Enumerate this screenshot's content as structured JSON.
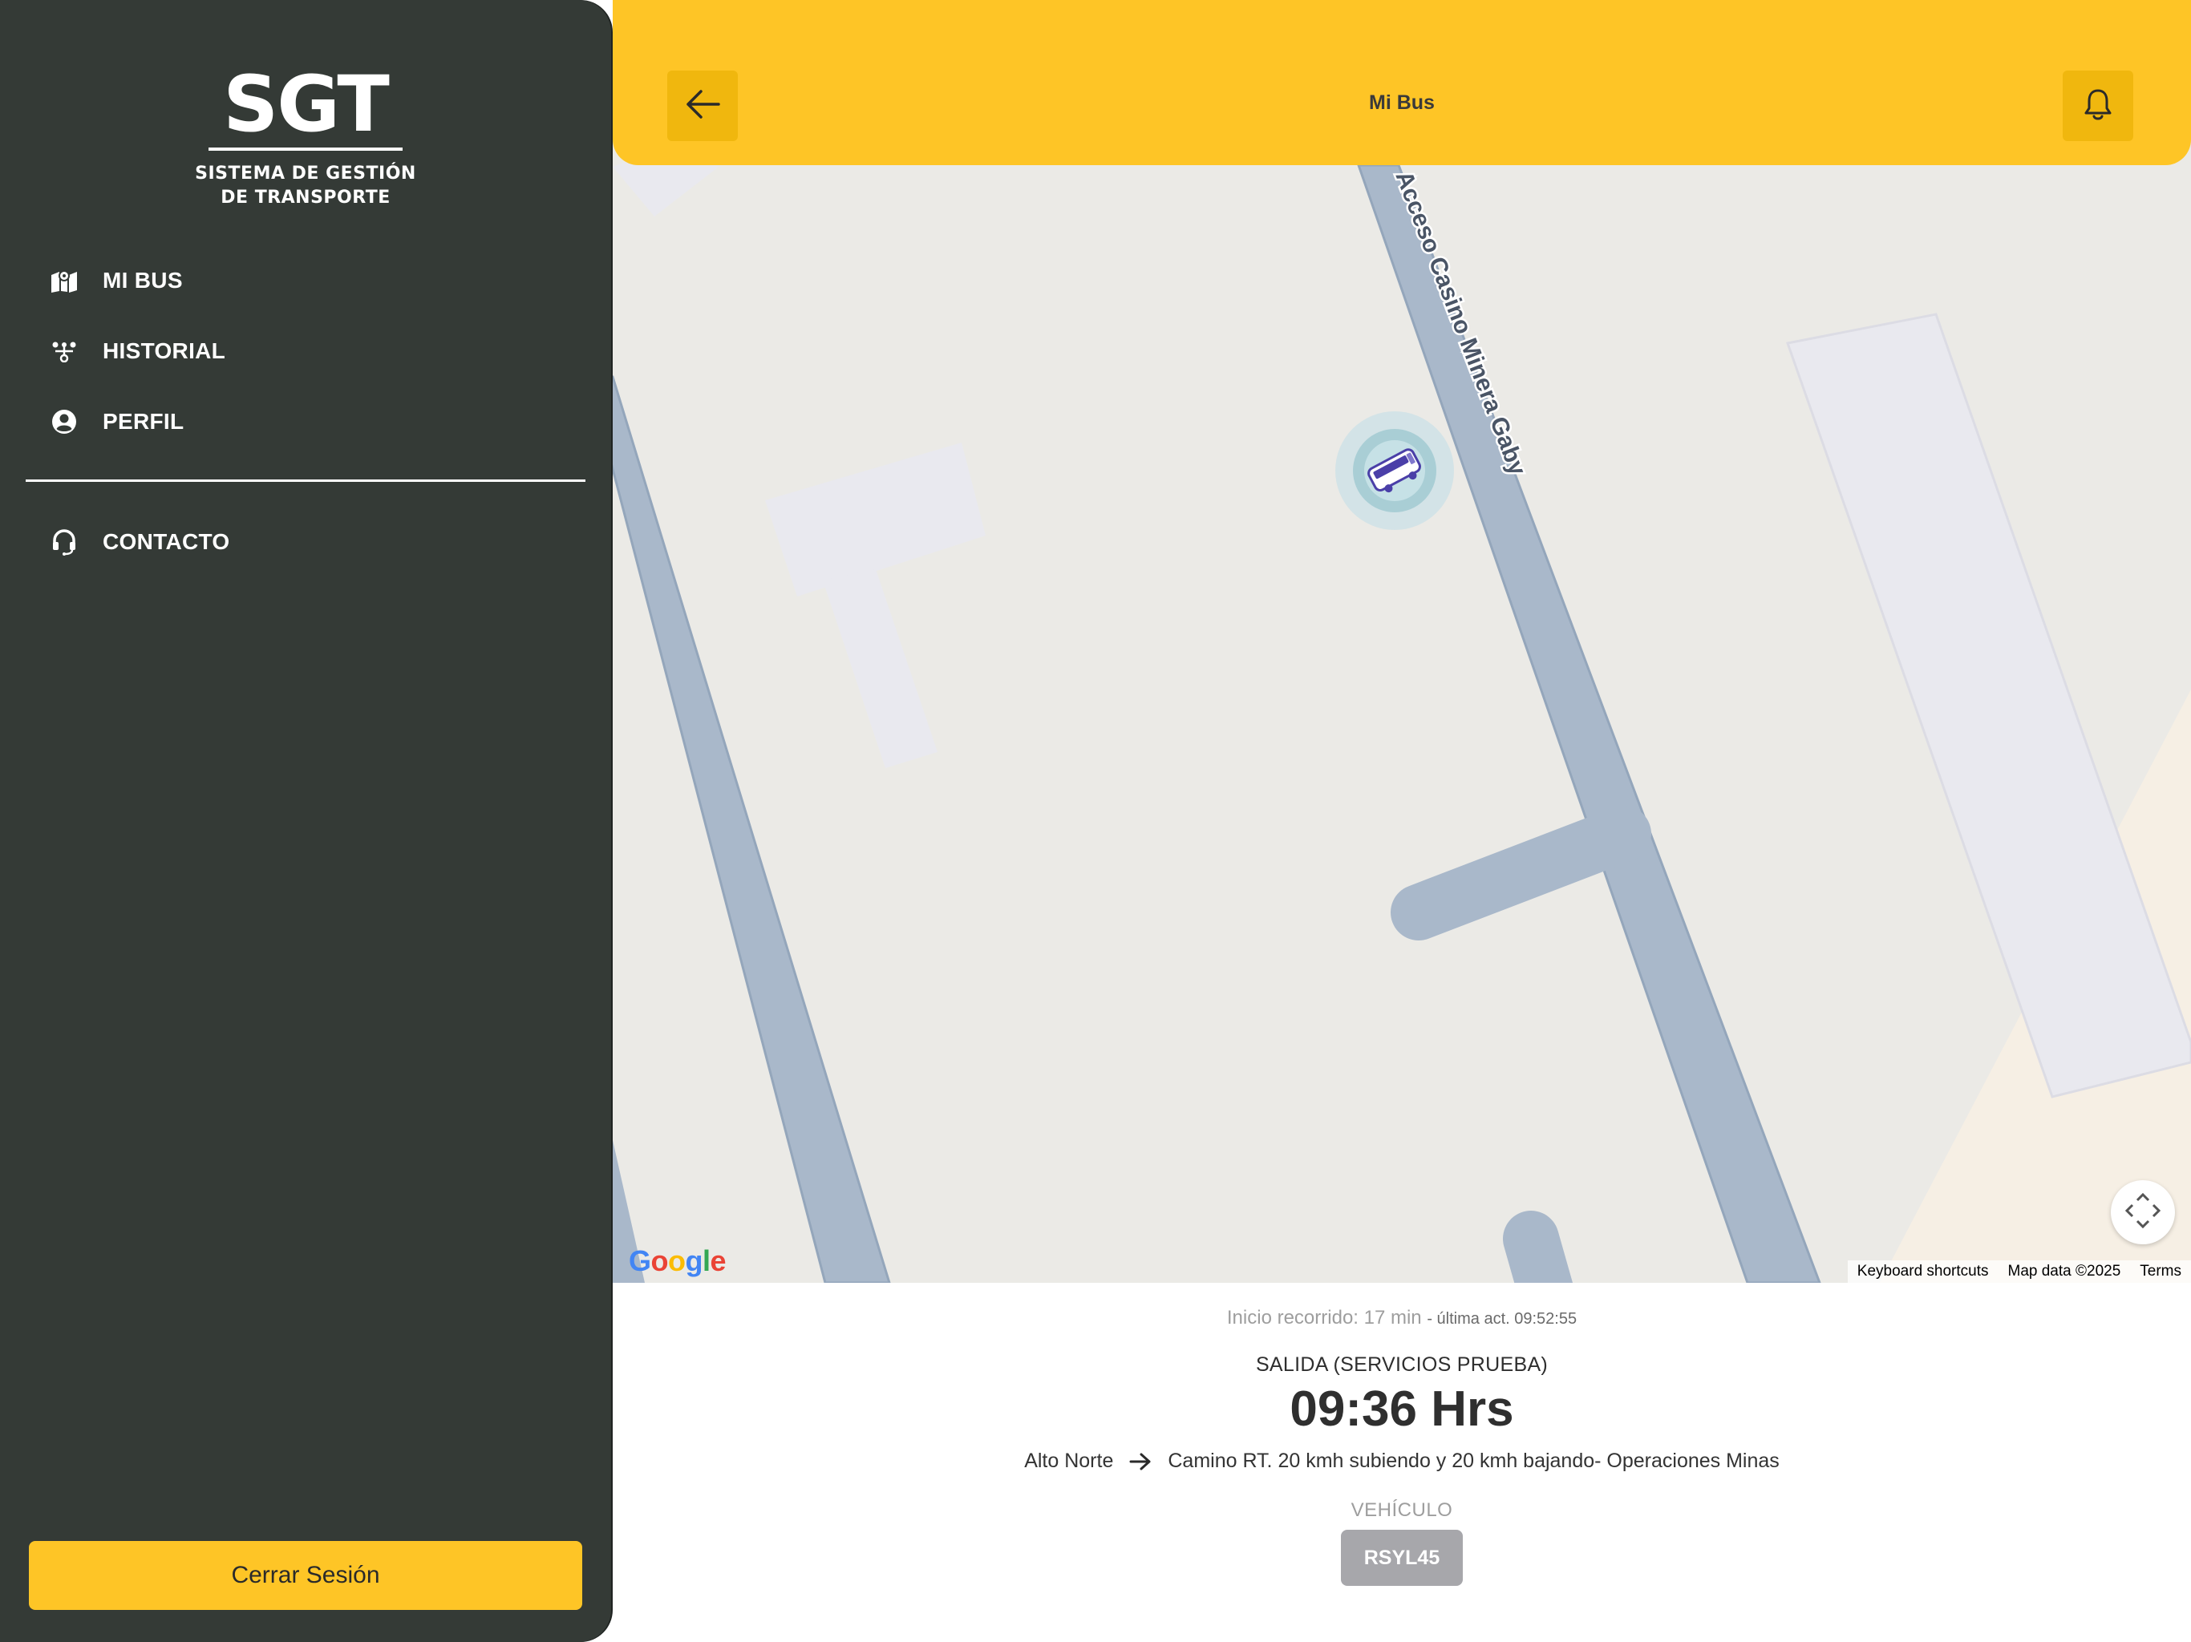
{
  "sidebar": {
    "logo": {
      "mark": "SGT",
      "line1": "SISTEMA DE GESTIÓN",
      "line2": "DE TRANSPORTE"
    },
    "items": [
      {
        "label": "MI BUS",
        "icon": "map-icon"
      },
      {
        "label": "HISTORIAL",
        "icon": "route-icon"
      },
      {
        "label": "PERFIL",
        "icon": "user-circle-icon"
      },
      {
        "label": "CONTACTO",
        "icon": "headset-icon"
      }
    ],
    "logout_label": "Cerrar Sesión"
  },
  "header": {
    "title": "Mi Bus",
    "back_icon": "arrow-left-icon",
    "notification_icon": "bell-icon"
  },
  "map": {
    "street_label": "Acceso Casino Minera Gaby",
    "provider": "Google",
    "attribution": {
      "shortcuts": "Keyboard shortcuts",
      "data": "Map data ©2025",
      "terms": "Terms"
    },
    "marker_icon": "bus-icon",
    "recenter_icon": "recenter-icon"
  },
  "trip": {
    "start_text": "Inicio recorrido: 17 min",
    "last_update_text": "- última act. 09:52:55",
    "departure_label": "SALIDA (SERVICIOS PRUEBA)",
    "departure_time": "09:36 Hrs",
    "origin": "Alto Norte",
    "destination": "Camino RT. 20 kmh subiendo y 20 kmh bajando- Operaciones Minas",
    "vehicle_label": "VEHÍCULO",
    "vehicle_plate": "RSYL45"
  },
  "colors": {
    "accent": "#fec526",
    "sidebar": "#343a36",
    "road": "#a9b8ca",
    "map_bg": "#ebeae6"
  }
}
